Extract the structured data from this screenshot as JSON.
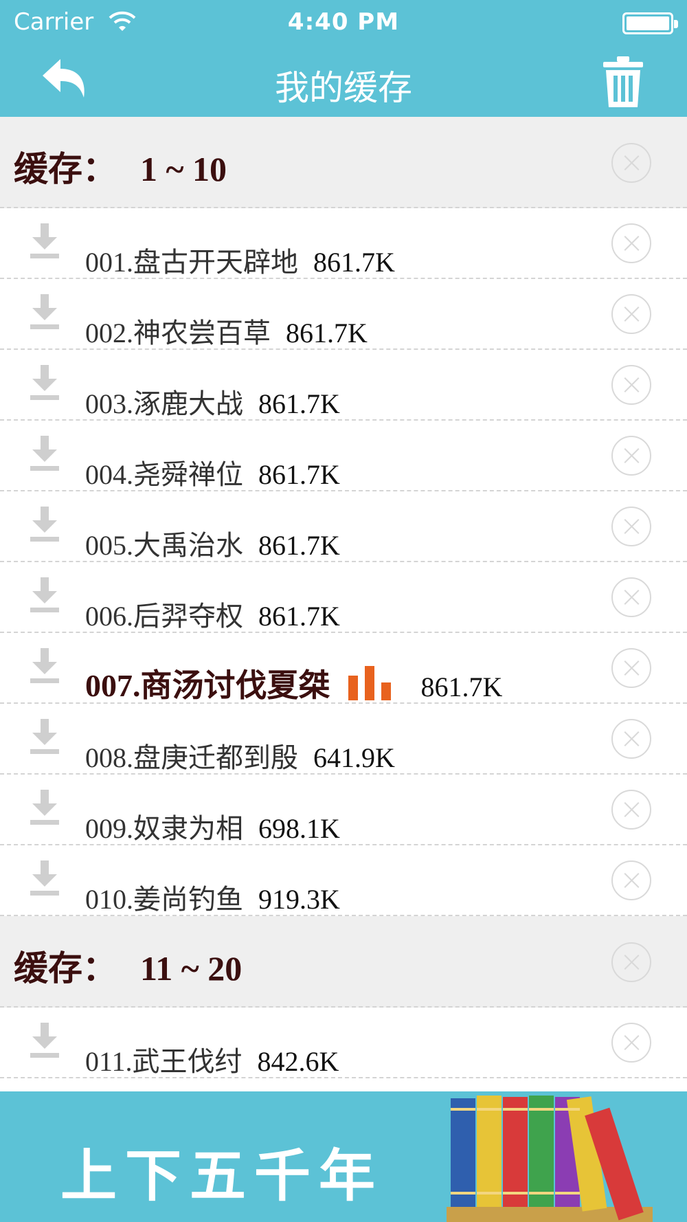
{
  "status_bar": {
    "carrier": "Carrier",
    "time": "4:40 PM"
  },
  "nav": {
    "title": "我的缓存",
    "back_icon": "back-arrow-icon",
    "trash_icon": "trash-icon"
  },
  "sections": [
    {
      "label": "缓存：",
      "range": "1 ~ 10",
      "items": [
        {
          "title": "001.盘古开天辟地",
          "size": "861.7K"
        },
        {
          "title": "002.神农尝百草",
          "size": "861.7K"
        },
        {
          "title": "003.涿鹿大战",
          "size": "861.7K"
        },
        {
          "title": "004.尧舜禅位",
          "size": "861.7K"
        },
        {
          "title": "005.大禹治水",
          "size": "861.7K"
        },
        {
          "title": "006.后羿夺权",
          "size": "861.7K"
        },
        {
          "title": "007.商汤讨伐夏桀",
          "size": "861.7K",
          "playing": true
        },
        {
          "title": "008.盘庚迁都到殷",
          "size": "641.9K"
        },
        {
          "title": "009.奴隶为相",
          "size": "698.1K"
        },
        {
          "title": "010.姜尚钓鱼",
          "size": "919.3K"
        }
      ]
    },
    {
      "label": "缓存：",
      "range": "11 ~ 20",
      "items": [
        {
          "title": "011.武王伐纣",
          "size": "842.6K"
        }
      ]
    }
  ],
  "banner": {
    "title": "上下五千年"
  },
  "colors": {
    "accent": "#5cc2d6",
    "playing_indicator": "#e8621e",
    "section_text": "#3b0f0f"
  }
}
